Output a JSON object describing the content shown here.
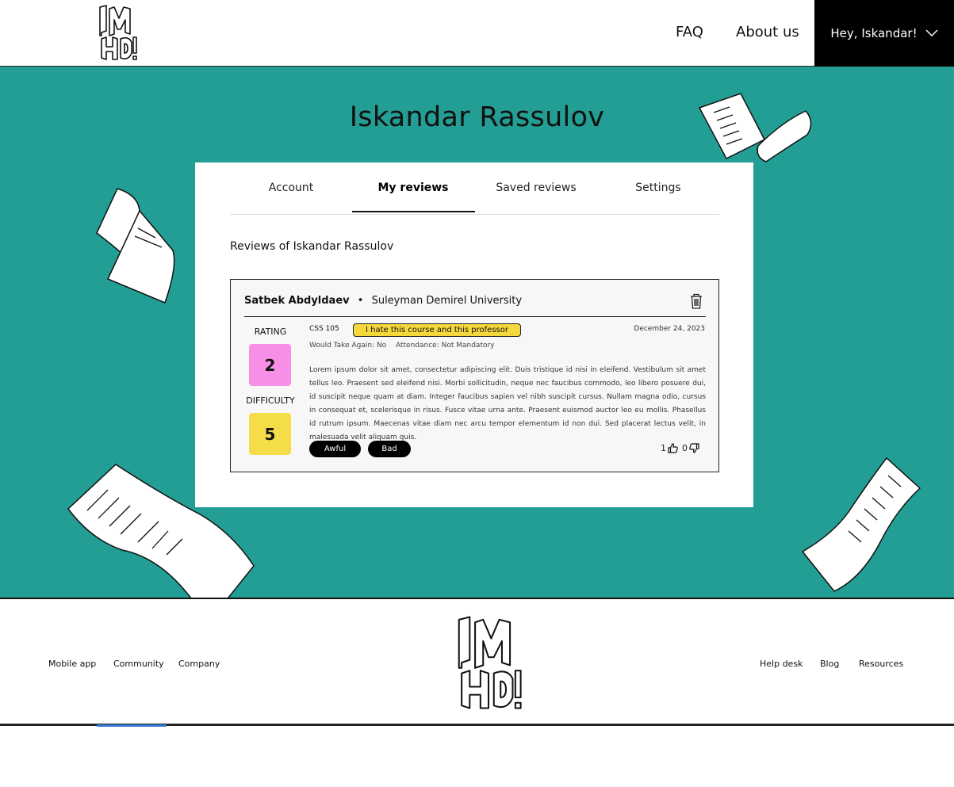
{
  "header": {
    "nav": [
      {
        "label": "FAQ"
      },
      {
        "label": "About us"
      }
    ],
    "user_menu_label": "Hey, Iskandar!"
  },
  "profile": {
    "name": "Iskandar Rassulov",
    "tabs": [
      {
        "label": "Account",
        "active": false
      },
      {
        "label": "My reviews",
        "active": true
      },
      {
        "label": "Saved reviews",
        "active": false
      },
      {
        "label": "Settings",
        "active": false
      }
    ],
    "section_title": "Reviews of Iskandar Rassulov"
  },
  "review": {
    "author": "Satbek Abdyldaev",
    "separator": "•",
    "university": "Suleyman Demirel University",
    "rating_label": "RATING",
    "rating": "2",
    "difficulty_label": "DIFFICULTY",
    "difficulty": "5",
    "course": "CSS 105",
    "tag": "I hate this course and this professor",
    "date": "December 24, 2023",
    "would_take_again": "Would Take Again: No",
    "attendance": "Attendance: Not Mandatory",
    "text": "Lorem ipsum dolor sit amet, consectetur adipiscing elit. Duis tristique id nisi in eleifend. Vestibulum sit amet tellus leo. Praesent sed eleifend nisi. Morbi sollicitudin, neque nec faucibus commodo, leo libero posuere dui, id suscipit neque quam at diam. Integer faucibus sapien vel nibh suscipit cursus. Nullam magna odio, cursus in consequat et, scelerisque in risus. Fusce vitae urna ante. Praesent euismod auctor leo eu mollis. Phasellus id rutrum ipsum. Maecenas vitae diam nec arcu tempor elementum id non dui. Sed placerat lectus velit, in malesuada velit aliquam quis.",
    "chips": [
      {
        "label": "Awful"
      },
      {
        "label": "Bad"
      }
    ],
    "likes": "1",
    "dislikes": "0"
  },
  "footer": {
    "left_links": [
      {
        "label": "Mobile app"
      },
      {
        "label": "Community"
      },
      {
        "label": "Company"
      }
    ],
    "right_links": [
      {
        "label": "Help desk"
      },
      {
        "label": "Blog"
      },
      {
        "label": "Resources"
      }
    ]
  },
  "colors": {
    "teal": "#239e94",
    "rating_box": "#f78fe6",
    "difficulty_box": "#f5dd4a",
    "tag_yellow": "#f5d83c"
  },
  "icons": [
    "imho-logo",
    "chevron-down-icon",
    "trash-icon",
    "thumbs-up-icon",
    "thumbs-down-icon",
    "paper-sheet-decoration"
  ]
}
